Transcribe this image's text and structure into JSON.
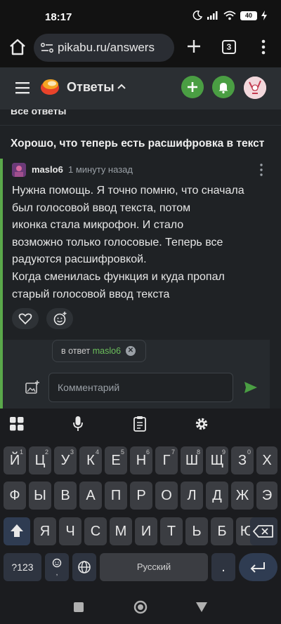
{
  "status_bar": {
    "time": "18:17",
    "battery": "40"
  },
  "browser": {
    "url": "pikabu.ru/answers",
    "tab_count": "3"
  },
  "app_header": {
    "title": "Ответы"
  },
  "content": {
    "cut_label": "Все ответы",
    "post_title": "Хорошо, что теперь есть расшифровка в текст",
    "comment": {
      "author": "maslo6",
      "time": "1 минуту назад",
      "lines": [
        "Нужна помощь. Я точно помню, что сначала",
        "был голосовой ввод текста, потом",
        "иконка стала микрофон. И стало",
        "возможно только голосовые. Теперь все",
        "радуются расшифровкой.",
        "Когда сменилась функция и куда пропал",
        "старый голосовой ввод текста"
      ]
    },
    "reply": {
      "chip_prefix": "в ответ",
      "chip_name": "maslo6",
      "placeholder": "Комментарий"
    }
  },
  "keyboard": {
    "row1": [
      "Й",
      "Ц",
      "У",
      "К",
      "Е",
      "Н",
      "Г",
      "Ш",
      "Щ",
      "З",
      "Х"
    ],
    "row1_sup": [
      "1",
      "2",
      "3",
      "4",
      "5",
      "6",
      "7",
      "8",
      "9",
      "0",
      ""
    ],
    "row2": [
      "Ф",
      "Ы",
      "В",
      "А",
      "П",
      "Р",
      "О",
      "Л",
      "Д",
      "Ж",
      "Э"
    ],
    "row3": [
      "Я",
      "Ч",
      "С",
      "М",
      "И",
      "Т",
      "Ь",
      "Б",
      "Ю"
    ],
    "numbers_key": "?123",
    "space_label": "Русский",
    "period_key": "."
  },
  "colors": {
    "accent_green": "#4a9e43",
    "header_bg": "#2b2f33",
    "content_bg": "#1f2225",
    "keyboard_bg": "#1b1c1f"
  }
}
